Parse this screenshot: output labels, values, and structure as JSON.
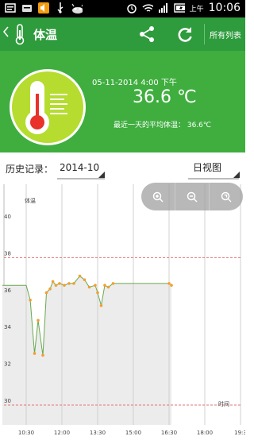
{
  "status_bar": {
    "time": "10:06",
    "ampm": "上午",
    "left_icons": [
      "sms-icon",
      "keyboard-icon",
      "sound-icon",
      "usb-icon",
      "android-icon"
    ],
    "right_icons": [
      "alarm-icon",
      "wifi-icon",
      "signal-icon",
      "battery-icon"
    ]
  },
  "header": {
    "title": "体温",
    "all_list_label": "所有列表"
  },
  "hero": {
    "date": "05-11-2014 4:00 下午",
    "temperature": "36.6 ℃",
    "average_text": "最近一天的平均体温： 36.6℃"
  },
  "history": {
    "label": "历史记录：",
    "month": "2014-10",
    "view": "日视图"
  },
  "colors": {
    "header_green": "#2e9b3d",
    "hero_green": "#3fae3f",
    "circle_lime": "#b5dc2f",
    "line_green": "#6aa84f",
    "point_orange": "#f0a030",
    "fill_grey": "#ececec",
    "ref_line_red": "#e57373"
  },
  "chart_data": {
    "type": "area",
    "ylabel": "体温",
    "xlabel": "时间",
    "ylim": [
      30,
      41
    ],
    "yticks": [
      30,
      32,
      34,
      36,
      38,
      40
    ],
    "xticks": [
      "10:30",
      "12:00",
      "13:30",
      "15:00",
      "16:30",
      "18:00",
      "19:3"
    ],
    "xticks_hours": [
      10.5,
      12,
      13.5,
      15,
      16.5,
      18,
      19.5
    ],
    "x_range_hours": [
      9.5,
      19.5
    ],
    "reference_lines": [
      38,
      30
    ],
    "series": [
      {
        "points": [
          [
            9.5,
            36.5
          ],
          [
            10.5,
            36.5
          ],
          [
            10.67,
            35.7
          ],
          [
            10.85,
            32.8
          ],
          [
            11.0,
            34.6
          ],
          [
            11.2,
            32.7
          ],
          [
            11.35,
            36.1
          ],
          [
            11.5,
            36.3
          ],
          [
            11.62,
            36.7
          ],
          [
            11.75,
            36.5
          ],
          [
            11.9,
            36.6
          ],
          [
            12.1,
            36.5
          ],
          [
            12.3,
            36.6
          ],
          [
            12.5,
            36.6
          ],
          [
            12.75,
            37.0
          ],
          [
            12.95,
            36.8
          ],
          [
            13.15,
            36.4
          ],
          [
            13.4,
            36.5
          ],
          [
            13.5,
            36.1
          ],
          [
            13.65,
            35.4
          ],
          [
            13.8,
            36.5
          ],
          [
            13.95,
            36.4
          ],
          [
            14.15,
            36.6
          ],
          [
            16.5,
            36.6
          ],
          [
            16.6,
            36.5
          ]
        ],
        "markers_from_index": 2
      }
    ]
  },
  "zoom_controls": [
    "zoom-in-icon",
    "zoom-out-icon",
    "zoom-reset-icon"
  ]
}
